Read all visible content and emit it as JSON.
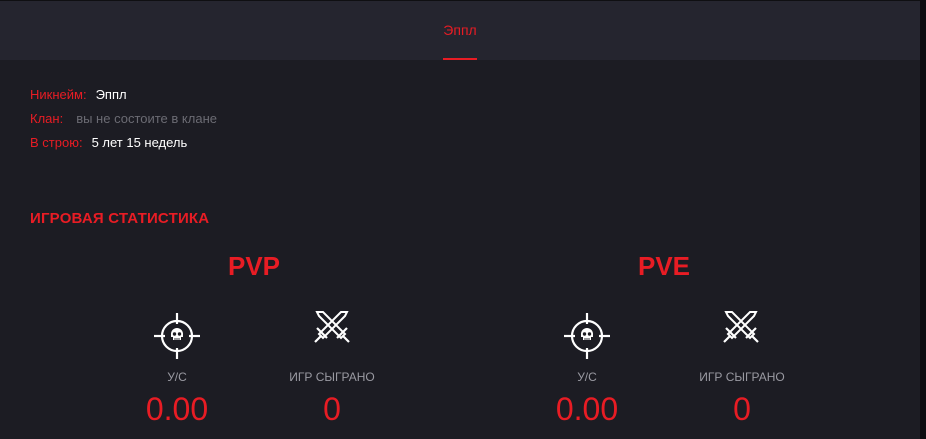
{
  "header": {
    "tab_label": "Эппл"
  },
  "profile": {
    "nickname_label": "Никнейм:",
    "nickname_value": "Эппл",
    "clan_label": "Клан:",
    "clan_value": "вы не состоите в клане",
    "service_label": "В строю:",
    "service_value": "5 лет 15 недель"
  },
  "stats": {
    "section_title": "ИГРОВАЯ СТАТИСТИКА",
    "pvp": {
      "title": "PVP",
      "kd_label": "У/С",
      "kd_value": "0.00",
      "games_label": "ИГР СЫГРАНО",
      "games_value": "0"
    },
    "pve": {
      "title": "PVE",
      "kd_label": "У/С",
      "kd_value": "0.00",
      "games_label": "ИГР СЫГРАНО",
      "games_value": "0"
    }
  },
  "icons": {
    "kd": "crosshair-skull-icon",
    "games": "crossed-swords-icon"
  },
  "colors": {
    "accent": "#e81c24",
    "background": "#1c1c23",
    "header": "#25252f",
    "muted_text": "#6b6b73",
    "label_text": "#9a9aa2"
  }
}
